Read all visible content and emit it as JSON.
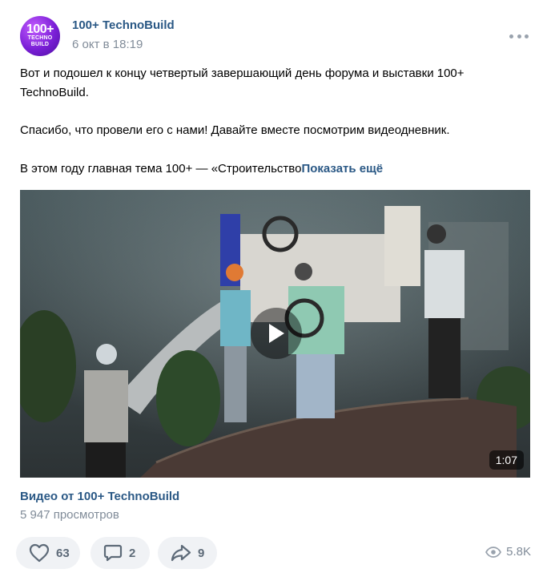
{
  "post": {
    "author": "100+ TechnoBuild",
    "date": "6 окт в 18:19",
    "avatar": {
      "big": "100+",
      "line1": "TECHNO",
      "line2": "BUILD"
    },
    "paragraph1": "Вот и подошел к концу четвертый завершающий день форума и выставки 100+ TechnoBuild.",
    "paragraph2": "Спасибо, что провели его с нами! Давайте вместе посмотрим видеодневник.",
    "paragraph3": "В этом году главная тема 100+ — «Строительство",
    "show_more": "Показать ещё"
  },
  "video": {
    "duration": "1:07",
    "title": "Видео от 100+ TechnoBuild",
    "views": "5 947 просмотров"
  },
  "actions": {
    "likes": "63",
    "comments": "2",
    "shares": "9",
    "views": "5.8K"
  },
  "colors": {
    "link": "#2a5885",
    "secondary": "#818c99",
    "action_bg": "#f0f2f5"
  }
}
